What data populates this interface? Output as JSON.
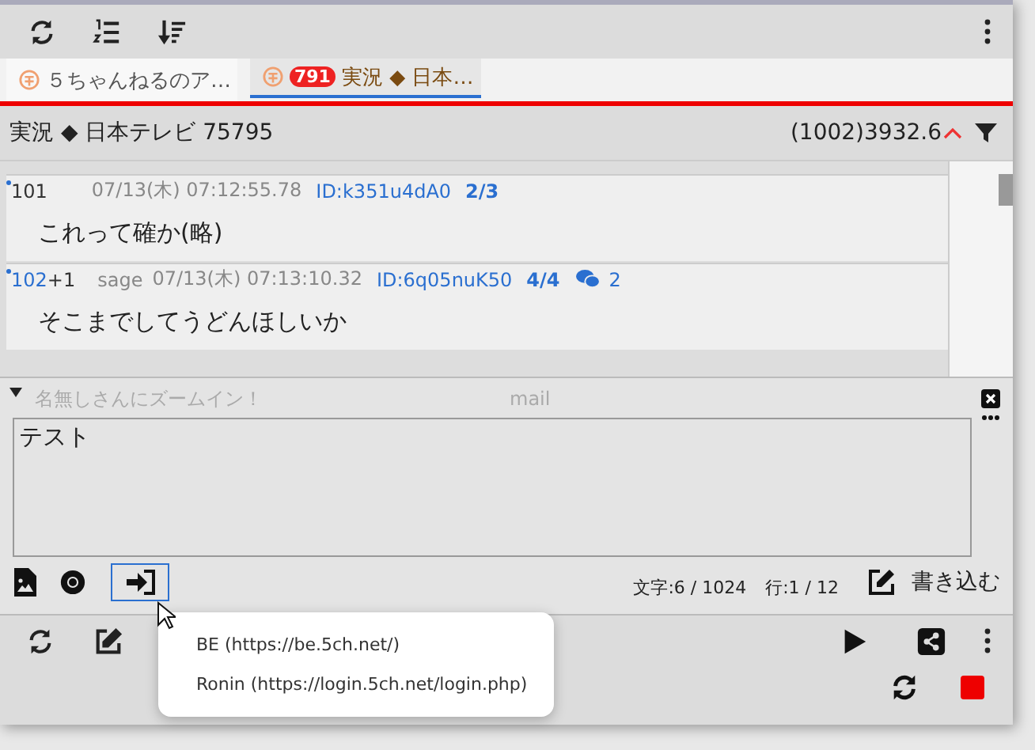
{
  "tabs": [
    {
      "label": "５ちゃんねるのア…",
      "selected": false
    },
    {
      "label": "実況 ◆ 日本…",
      "badge": "791",
      "selected": true
    }
  ],
  "thread": {
    "title": "実況 ◆ 日本テレビ 75795",
    "speed": "(1002)3932.6"
  },
  "posts": [
    {
      "number": "101",
      "date": "07/13(木) 07:12:55.78",
      "id": "ID:k351u4dA0",
      "id_count": "2/3",
      "body": "これって確か(略)"
    },
    {
      "number": "102",
      "plus": "+1",
      "mail": "sage",
      "date": "07/13(木) 07:13:10.32",
      "id": "ID:6q05nuK50",
      "id_count": "4/4",
      "replies": "2",
      "body": "そこまでしてうどんほしいか"
    }
  ],
  "compose": {
    "name_placeholder": "名無しさんにズームイン！",
    "mail_placeholder": "mail",
    "body": "テスト",
    "char_count": "文字:6 / 1024",
    "line_count": "行:1 / 12",
    "submit": "書き込む"
  },
  "login_menu": [
    {
      "label": "BE (https://be.5ch.net/)"
    },
    {
      "label": "Ronin (https://login.5ch.net/login.php)"
    }
  ]
}
